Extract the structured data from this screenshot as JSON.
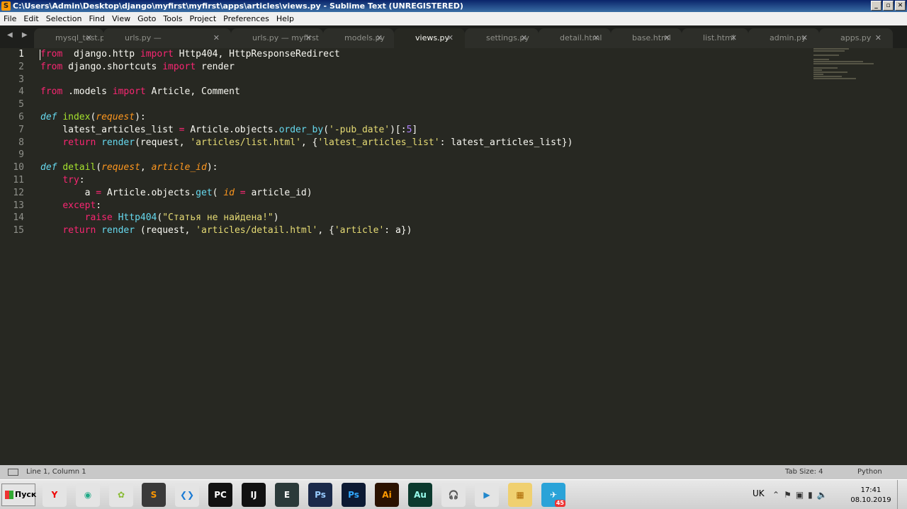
{
  "window": {
    "title": "C:\\Users\\Admin\\Desktop\\django\\myfirst\\myfirst\\apps\\articles\\views.py - Sublime Text (UNREGISTERED)",
    "buttons": [
      "_",
      "▫",
      "✕"
    ]
  },
  "menu": [
    "File",
    "Edit",
    "Selection",
    "Find",
    "View",
    "Goto",
    "Tools",
    "Project",
    "Preferences",
    "Help"
  ],
  "tabs": [
    {
      "label": "mysql_test.py",
      "active": false
    },
    {
      "label": "urls.py — myfirst\\apps\\articles",
      "active": false
    },
    {
      "label": "urls.py — myfirst",
      "active": false
    },
    {
      "label": "models.py",
      "active": false
    },
    {
      "label": "views.py",
      "active": true
    },
    {
      "label": "settings.py",
      "active": false
    },
    {
      "label": "detail.html",
      "active": false
    },
    {
      "label": "base.html",
      "active": false
    },
    {
      "label": "list.html",
      "active": false
    },
    {
      "label": "admin.py",
      "active": false
    },
    {
      "label": "apps.py",
      "active": false
    }
  ],
  "tab_nav": "◀ ▶",
  "tab_close": "✕",
  "editor": {
    "line_numbers": [
      "1",
      "2",
      "3",
      "4",
      "5",
      "6",
      "7",
      "8",
      "9",
      "10",
      "11",
      "12",
      "13",
      "14",
      "15"
    ],
    "lines": [
      [
        [
          "k",
          "from"
        ],
        [
          "",
          "  django.http "
        ],
        [
          "k",
          "import"
        ],
        [
          "",
          " Http404, HttpResponseRedirect"
        ]
      ],
      [
        [
          "k",
          "from"
        ],
        [
          "",
          " django.shortcuts "
        ],
        [
          "k",
          "import"
        ],
        [
          "",
          " render"
        ]
      ],
      [],
      [
        [
          "k",
          "from"
        ],
        [
          "",
          " .models "
        ],
        [
          "k",
          "import"
        ],
        [
          "",
          " Article, Comment"
        ]
      ],
      [],
      [
        [
          "d",
          "def"
        ],
        [
          "",
          " "
        ],
        [
          "f",
          "index"
        ],
        [
          "",
          "("
        ],
        [
          "p",
          "request"
        ],
        [
          "",
          "):"
        ]
      ],
      [
        [
          "",
          "    latest_articles_list "
        ],
        [
          "k",
          "="
        ],
        [
          "",
          " Article.objects."
        ],
        [
          "c",
          "order_by"
        ],
        [
          "",
          "("
        ],
        [
          "s",
          "'-pub_date'"
        ],
        [
          "",
          ")[:"
        ],
        [
          "n",
          "5"
        ],
        [
          "",
          "]"
        ]
      ],
      [
        [
          "",
          "    "
        ],
        [
          "k",
          "return"
        ],
        [
          "",
          " "
        ],
        [
          "c",
          "render"
        ],
        [
          "",
          "(request, "
        ],
        [
          "s",
          "'articles/list.html'"
        ],
        [
          "",
          ", {"
        ],
        [
          "s",
          "'latest_articles_list'"
        ],
        [
          "",
          ": latest_articles_list})"
        ]
      ],
      [],
      [
        [
          "d",
          "def"
        ],
        [
          "",
          " "
        ],
        [
          "f",
          "detail"
        ],
        [
          "",
          "("
        ],
        [
          "p",
          "request"
        ],
        [
          "",
          ", "
        ],
        [
          "p",
          "article_id"
        ],
        [
          "",
          "):"
        ]
      ],
      [
        [
          "",
          "    "
        ],
        [
          "k",
          "try"
        ],
        [
          "",
          ":"
        ]
      ],
      [
        [
          "",
          "        a "
        ],
        [
          "k",
          "="
        ],
        [
          "",
          " Article.objects."
        ],
        [
          "c",
          "get"
        ],
        [
          "",
          "( "
        ],
        [
          "p",
          "id"
        ],
        [
          "",
          " "
        ],
        [
          "k",
          "="
        ],
        [
          "",
          " article_id)"
        ]
      ],
      [
        [
          "",
          "    "
        ],
        [
          "k",
          "except"
        ],
        [
          "",
          ":"
        ]
      ],
      [
        [
          "",
          "        "
        ],
        [
          "k",
          "raise"
        ],
        [
          "",
          " "
        ],
        [
          "c",
          "Http404"
        ],
        [
          "",
          "("
        ],
        [
          "s",
          "\"Статья не найдена!\""
        ],
        [
          "",
          ")"
        ]
      ],
      [
        [
          "",
          "    "
        ],
        [
          "k",
          "return"
        ],
        [
          "",
          " "
        ],
        [
          "c",
          "render"
        ],
        [
          "",
          " (request, "
        ],
        [
          "s",
          "'articles/detail.html'"
        ],
        [
          "",
          ", {"
        ],
        [
          "s",
          "'article'"
        ],
        [
          "",
          ": a})"
        ]
      ]
    ]
  },
  "status": {
    "position": "Line 1, Column 1",
    "tab_size": "Tab Size: 4",
    "syntax": "Python"
  },
  "taskbar": {
    "start_label": "Пуск",
    "apps": [
      {
        "name": "yandex-browser",
        "glyph": "Y",
        "color": "#e4e4e4",
        "fg": "#e00"
      },
      {
        "name": "chrome",
        "glyph": "◉",
        "color": "#e4e4e4",
        "fg": "#2a8"
      },
      {
        "name": "lime-app",
        "glyph": "✿",
        "color": "#e4e4e4",
        "fg": "#8b3"
      },
      {
        "name": "sublime-text",
        "glyph": "S",
        "color": "#3a3a3a",
        "fg": "#ff9800"
      },
      {
        "name": "vscode",
        "glyph": "❮❯",
        "color": "#e4e4e4",
        "fg": "#1a7ad4"
      },
      {
        "name": "pycharm",
        "glyph": "PC",
        "color": "#111",
        "fg": "#fff"
      },
      {
        "name": "intellij",
        "glyph": "IJ",
        "color": "#111",
        "fg": "#fff"
      },
      {
        "name": "eclipse-ide",
        "glyph": "E",
        "color": "#2b3a3a",
        "fg": "#fff"
      },
      {
        "name": "photoshop-1",
        "glyph": "Ps",
        "color": "#1b2a4a",
        "fg": "#9cf"
      },
      {
        "name": "photoshop-2",
        "glyph": "Ps",
        "color": "#0d1a33",
        "fg": "#31a8ff"
      },
      {
        "name": "illustrator",
        "glyph": "Ai",
        "color": "#2b1200",
        "fg": "#ff9a00"
      },
      {
        "name": "audition",
        "glyph": "Au",
        "color": "#0c3a2e",
        "fg": "#9fe"
      },
      {
        "name": "headphones-app",
        "glyph": "🎧",
        "color": "#e4e4e4",
        "fg": "#71c"
      },
      {
        "name": "media-player",
        "glyph": "▶",
        "color": "#e4e4e4",
        "fg": "#28c"
      },
      {
        "name": "file-explorer",
        "glyph": "▦",
        "color": "#f0d070",
        "fg": "#a60"
      },
      {
        "name": "telegram",
        "glyph": "✈",
        "color": "#2aa3d8",
        "fg": "#fff",
        "badge": "45"
      }
    ],
    "language": "UK",
    "tray_icons": [
      "chevron-icon",
      "flag-icon",
      "network-icon",
      "signal-icon",
      "volume-icon"
    ],
    "time": "17:41",
    "date": "08.10.2019"
  }
}
